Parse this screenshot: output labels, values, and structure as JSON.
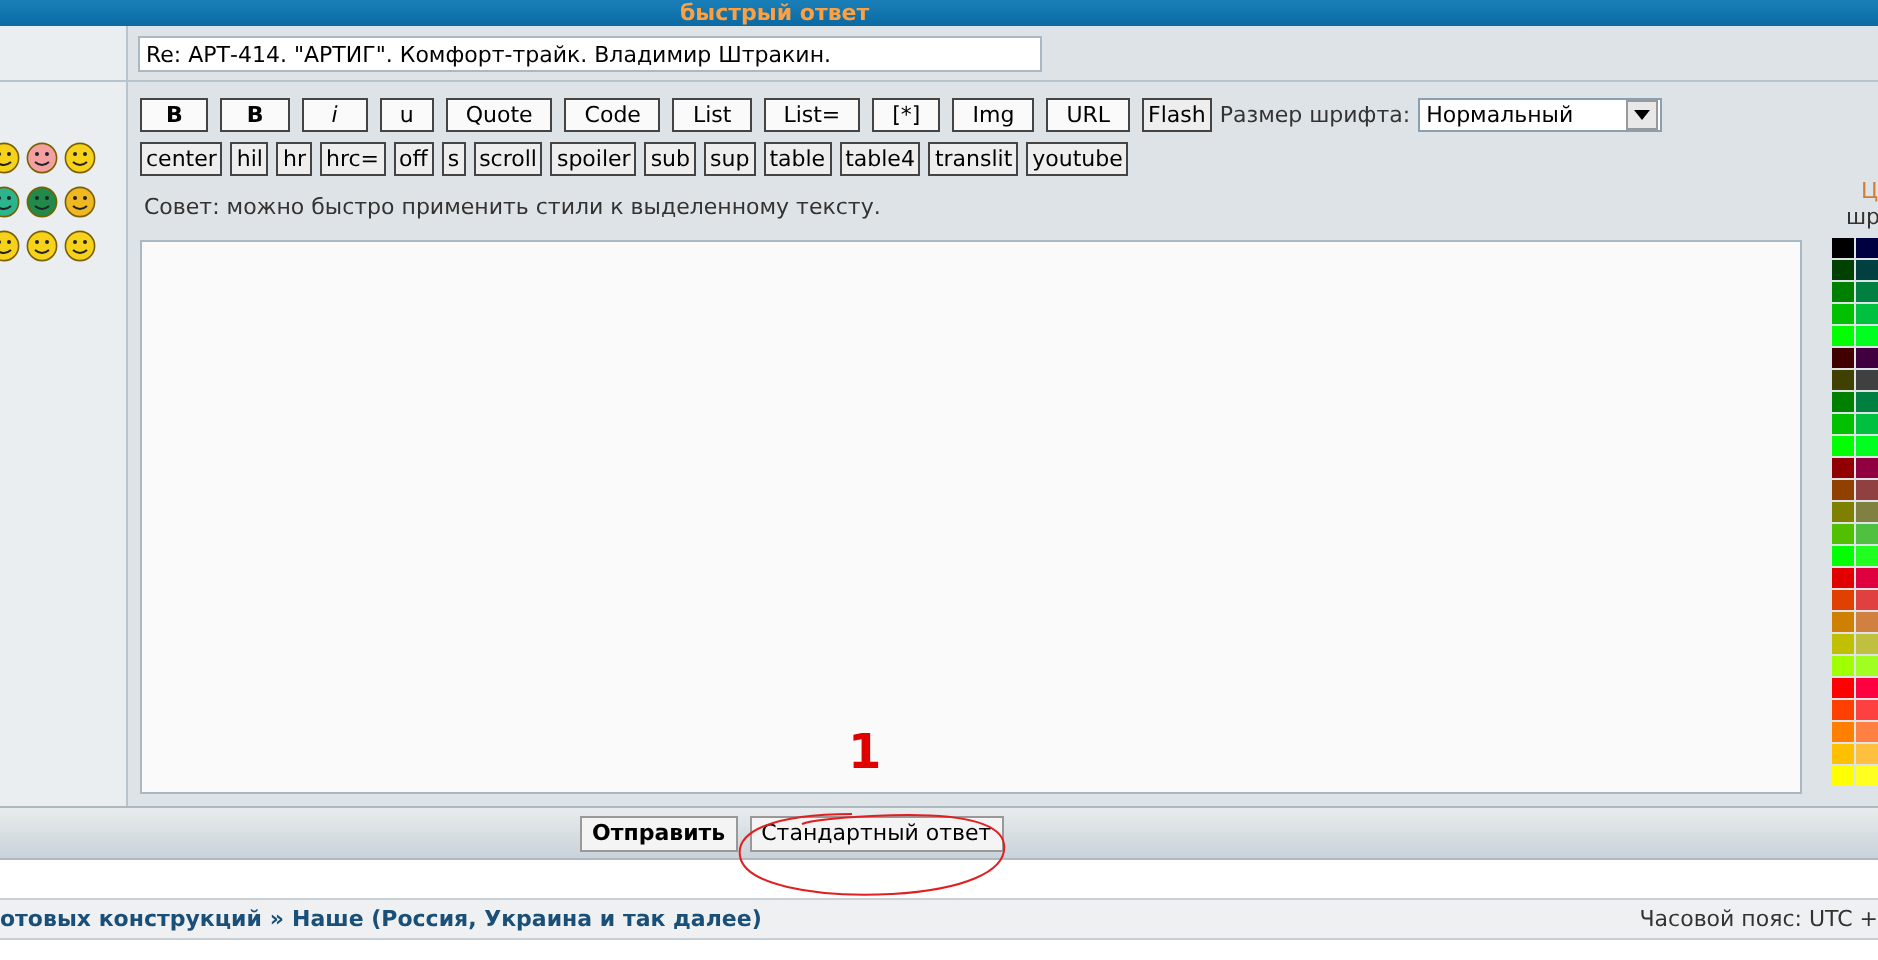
{
  "header": {
    "title": "быстрый ответ"
  },
  "subject": {
    "value": "Re: АРТ-414. \"АРТИГ\". Комфорт-трайк. Владимир Штракин."
  },
  "toolbar_row_1": [
    "B",
    "B",
    "i",
    "u",
    "Quote",
    "Code",
    "List",
    "List=",
    "[*]",
    "Img",
    "URL",
    "Flash"
  ],
  "font_size": {
    "label": "Размер шрифта:",
    "value": "Нормальный"
  },
  "toolbar_row_2": [
    "center",
    "hil",
    "hr",
    "hrc=",
    "off",
    "s",
    "scroll",
    "spoiler",
    "sub",
    "sup",
    "table",
    "table4",
    "translit",
    "youtube"
  ],
  "tip": "Совет: можно быстро применить стили к выделенному тексту.",
  "color_label": [
    "Ц",
    "шр"
  ],
  "color_swatches": [
    {
      "color": "#000000"
    },
    {
      "color": "#000040"
    },
    {
      "color": "#004000"
    },
    {
      "color": "#004040"
    },
    {
      "color": "#008000"
    },
    {
      "color": "#008040"
    },
    {
      "color": "#00c000"
    },
    {
      "color": "#00c040"
    },
    {
      "color": "#00ff00"
    },
    {
      "color": "#00ff20"
    },
    {
      "color": "#400000"
    },
    {
      "color": "#400040"
    },
    {
      "color": "#404000"
    },
    {
      "color": "#404040"
    },
    {
      "color": "#008000"
    },
    {
      "color": "#008040"
    },
    {
      "color": "#00c000"
    },
    {
      "color": "#00c040"
    },
    {
      "color": "#00ff00"
    },
    {
      "color": "#00ff20"
    },
    {
      "color": "#900000"
    },
    {
      "color": "#900040"
    },
    {
      "color": "#904000"
    },
    {
      "color": "#904040"
    },
    {
      "color": "#808000"
    },
    {
      "color": "#808040"
    },
    {
      "color": "#50c000"
    },
    {
      "color": "#50c040"
    },
    {
      "color": "#00ff00"
    },
    {
      "color": "#20ff20"
    },
    {
      "color": "#e00000"
    },
    {
      "color": "#e00040"
    },
    {
      "color": "#e04000"
    },
    {
      "color": "#e04040"
    },
    {
      "color": "#d08000"
    },
    {
      "color": "#d08040"
    },
    {
      "color": "#c0c000"
    },
    {
      "color": "#c0c040"
    },
    {
      "color": "#a0ff00"
    },
    {
      "color": "#a0ff20"
    },
    {
      "color": "#ff0000"
    },
    {
      "color": "#ff0040"
    },
    {
      "color": "#ff4000"
    },
    {
      "color": "#ff4040"
    },
    {
      "color": "#ff8000"
    },
    {
      "color": "#ff8040"
    },
    {
      "color": "#ffc000"
    },
    {
      "color": "#ffc040"
    },
    {
      "color": "#ffff00"
    },
    {
      "color": "#ffff20"
    }
  ],
  "buttons": [
    {
      "label": "Отправить",
      "primary": true
    },
    {
      "label": "Стандартный ответ",
      "primary": false
    }
  ],
  "annotation": {
    "label": "1"
  },
  "breadcrumb": [
    "отовых конструкций",
    "»",
    "Наше (Россия, Украина и так далее)"
  ],
  "timezone": "Часовой пояс: UTC +"
}
